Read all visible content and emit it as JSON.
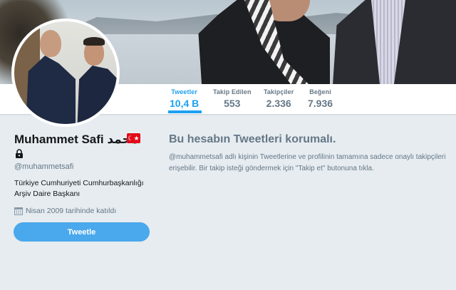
{
  "profile": {
    "name": "Muhammet Safi محمد",
    "flag_symbol": "☾★",
    "handle": "@muhammetsafi",
    "bio_lines": [
      "Türkiye Cumhuriyeti Cumhurbaşkanlığı",
      "Arşiv Daire Başkanı"
    ],
    "joined": "Nisan 2009 tarihinde katıldı",
    "tweet_button_label": "Tweetle"
  },
  "nav": [
    {
      "label": "Tweetler",
      "value": "10,4 B",
      "active": true
    },
    {
      "label": "Takip Edilen",
      "value": "553",
      "active": false
    },
    {
      "label": "Takipçiler",
      "value": "2.336",
      "active": false
    },
    {
      "label": "Beğeni",
      "value": "7.936",
      "active": false
    }
  ],
  "protected": {
    "title": "Bu hesabın Tweetleri korumalı.",
    "text_lines": [
      "@muhammetsafi adlı kişinin Tweetlerine ve profilinin tamamına sadece onaylı takipçileri",
      "erişebilir. Bir takip isteği göndermek için \"Takip et\" butonuna tıkla."
    ]
  },
  "colors": {
    "accent": "#1da1f2",
    "button": "#4aa8ec",
    "background": "#e6ecf0",
    "muted_text": "#657786",
    "flag_red": "#e30a17"
  },
  "icons": [
    "lock-icon",
    "calendar-icon"
  ]
}
